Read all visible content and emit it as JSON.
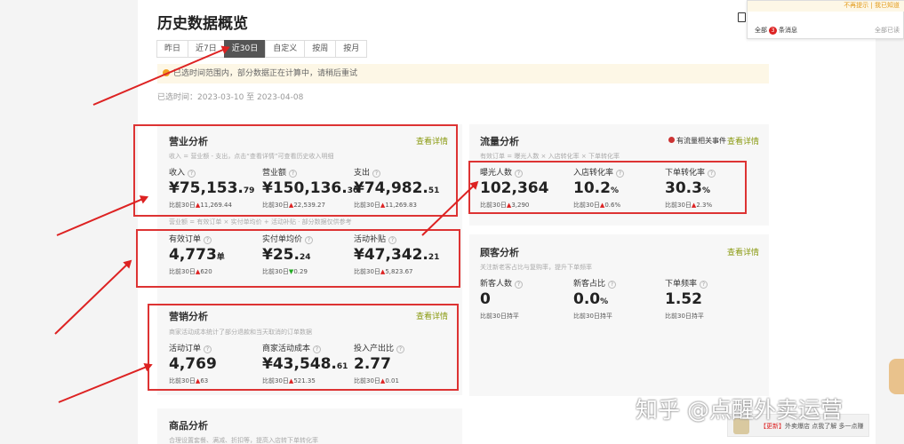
{
  "page_title": "历史数据概览",
  "tabs": [
    "昨日",
    "近7日",
    "近30日",
    "自定义",
    "按周",
    "按月"
  ],
  "notice": "已选时间范围内，部分数据正在计算中，请稍后重试",
  "date_range": "已选时间：2023-03-10 至 2023-04-08",
  "popup": {
    "top_link": "不再提示 | 我已知道",
    "all_label": "全部",
    "badge": "3",
    "count_text": "条消息",
    "read_all": "全部已读"
  },
  "business": {
    "title": "营业分析",
    "link": "查看详情",
    "desc": "收入 = 营业额 - 支出，点击“查看详情”可查看历史收入明细",
    "metrics": [
      {
        "label": "收入",
        "value": "¥75,153.",
        "decimal": "79",
        "compare_label": "比前30日",
        "arrow": "▲",
        "compare": "11,269.44"
      },
      {
        "label": "营业额",
        "value": "¥150,136.",
        "decimal": "30",
        "compare_label": "比前30日",
        "arrow": "▲",
        "compare": "22,539.27"
      },
      {
        "label": "支出",
        "value": "¥74,982.",
        "decimal": "51",
        "compare_label": "比前30日",
        "arrow": "▲",
        "compare": "11,269.83"
      }
    ],
    "desc2": "营业额 = 有效订单 × 实付单均价 + 活动补贴 · 部分数据仅供参考",
    "metrics2": [
      {
        "label": "有效订单",
        "value": "4,773",
        "decimal": "单",
        "compare_label": "比前30日",
        "arrow": "▲",
        "compare": "620"
      },
      {
        "label": "实付单均价",
        "value": "¥25.",
        "decimal": "24",
        "compare_label": "比前30日",
        "arrow": "▼",
        "compare": "0.29"
      },
      {
        "label": "活动补贴",
        "value": "¥47,342.",
        "decimal": "21",
        "compare_label": "比前30日",
        "arrow": "▲",
        "compare": "5,823.67"
      }
    ]
  },
  "marketing": {
    "title": "营销分析",
    "link": "查看详情",
    "desc": "商家活动成本统计了部分退款和当天取消的订单数据",
    "metrics": [
      {
        "label": "活动订单",
        "value": "4,769",
        "decimal": "",
        "compare_label": "比前30日",
        "arrow": "▲",
        "compare": "63"
      },
      {
        "label": "商家活动成本",
        "value": "¥43,548.",
        "decimal": "61",
        "compare_label": "比前30日",
        "arrow": "▲",
        "compare": "521.35"
      },
      {
        "label": "投入产出比",
        "value": "2.77",
        "decimal": "",
        "compare_label": "比前30日",
        "arrow": "▲",
        "compare": "0.01"
      }
    ]
  },
  "goods": {
    "title": "商品分析",
    "desc": "合理设置套餐、满减、折扣等，提高入店转下单转化率"
  },
  "traffic": {
    "title": "流量分析",
    "alert": "有流量相关事件",
    "link": "查看详情",
    "desc": "有效订单 = 曝光人数 × 入店转化率 × 下单转化率",
    "metrics": [
      {
        "label": "曝光人数",
        "value": "102,364",
        "decimal": "",
        "compare_label": "比前30日",
        "arrow": "▲",
        "compare": "3,290"
      },
      {
        "label": "入店转化率",
        "value": "10.2",
        "decimal": "%",
        "compare_label": "比前30日",
        "arrow": "▲",
        "compare": "0.6%"
      },
      {
        "label": "下单转化率",
        "value": "30.3",
        "decimal": "%",
        "compare_label": "比前30日",
        "arrow": "▲",
        "compare": "2.3%"
      }
    ]
  },
  "customer": {
    "title": "顾客分析",
    "link": "查看详情",
    "desc": "关注新老客占比与复购率，提升下单频率",
    "metrics": [
      {
        "label": "新客人数",
        "value": "0",
        "decimal": "",
        "compare_label": "比前30日",
        "arrow": "",
        "compare": "持平"
      },
      {
        "label": "新客占比",
        "value": "0.0",
        "decimal": "%",
        "compare_label": "比前30日",
        "arrow": "",
        "compare": "持平"
      },
      {
        "label": "下单频率",
        "value": "1.52",
        "decimal": "",
        "compare_label": "比前30日",
        "arrow": "",
        "compare": "持平"
      }
    ]
  },
  "bottom_pill": {
    "tag": "【更新】",
    "text": "外卖爆店",
    "sub": "点我了解 多一点赚"
  },
  "watermark": "知乎 @点醒外卖运营",
  "colors": {
    "accent": "#8a9a10",
    "red": "#d33",
    "tab_active": "#555555"
  }
}
